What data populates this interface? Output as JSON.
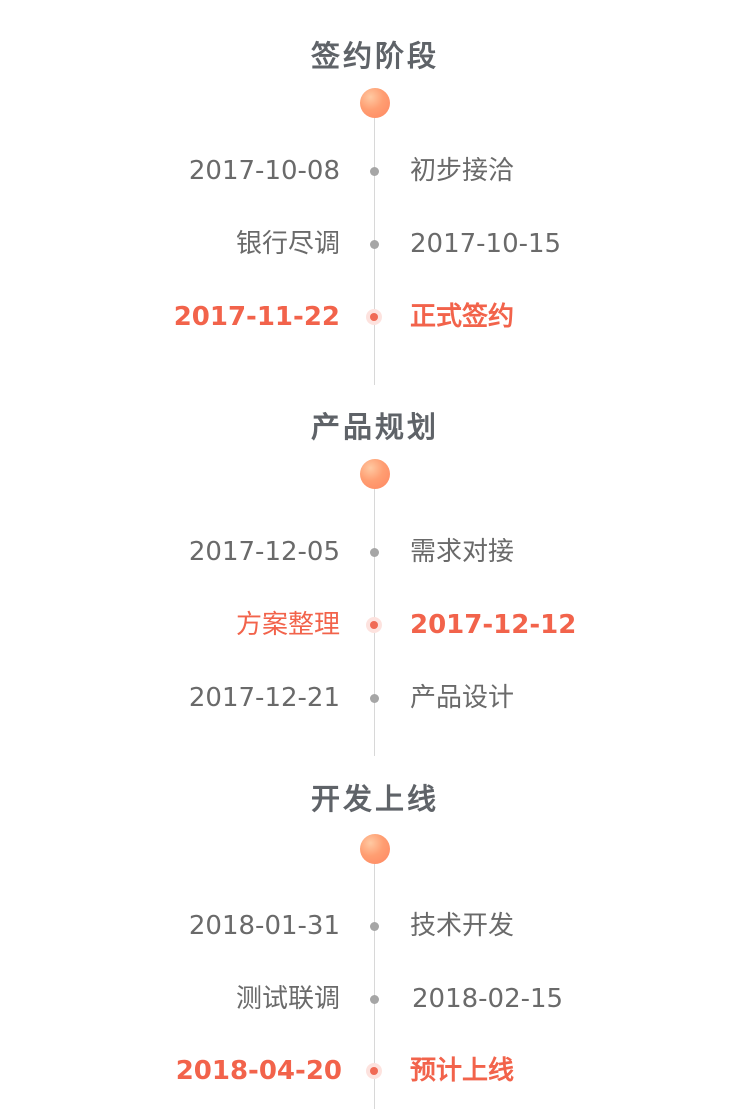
{
  "sections": [
    {
      "title": "签约阶段",
      "rows": [
        {
          "left": "2017-10-08",
          "right": "初步接洽",
          "highlight": false
        },
        {
          "left": "银行尽调",
          "right": "2017-10-15",
          "highlight": false
        },
        {
          "left": "2017-11-22",
          "right": "正式签约",
          "highlight": true
        }
      ]
    },
    {
      "title": "产品规划",
      "rows": [
        {
          "left": "2017-12-05",
          "right": "需求对接",
          "highlight": false
        },
        {
          "left": "方案整理",
          "right": "2017-12-12",
          "highlight": true
        },
        {
          "left": "2017-12-21",
          "right": "产品设计",
          "highlight": false
        }
      ]
    },
    {
      "title": "开发上线",
      "rows": [
        {
          "left": "2018-01-31",
          "right": "技术开发",
          "highlight": false
        },
        {
          "left": "测试联调",
          "right": "2018-02-15",
          "highlight": false
        },
        {
          "left": "2018-04-20",
          "right": "预计上线",
          "highlight": true
        }
      ]
    }
  ],
  "colors": {
    "title": "#5f6368",
    "text": "#6a6a6a",
    "highlight": "#f2634b",
    "line": "#d8d8d8",
    "dot": "#a6a6a6",
    "milestone_gradient_start": "#ffc9a2",
    "milestone_gradient_end": "#ff8660"
  }
}
